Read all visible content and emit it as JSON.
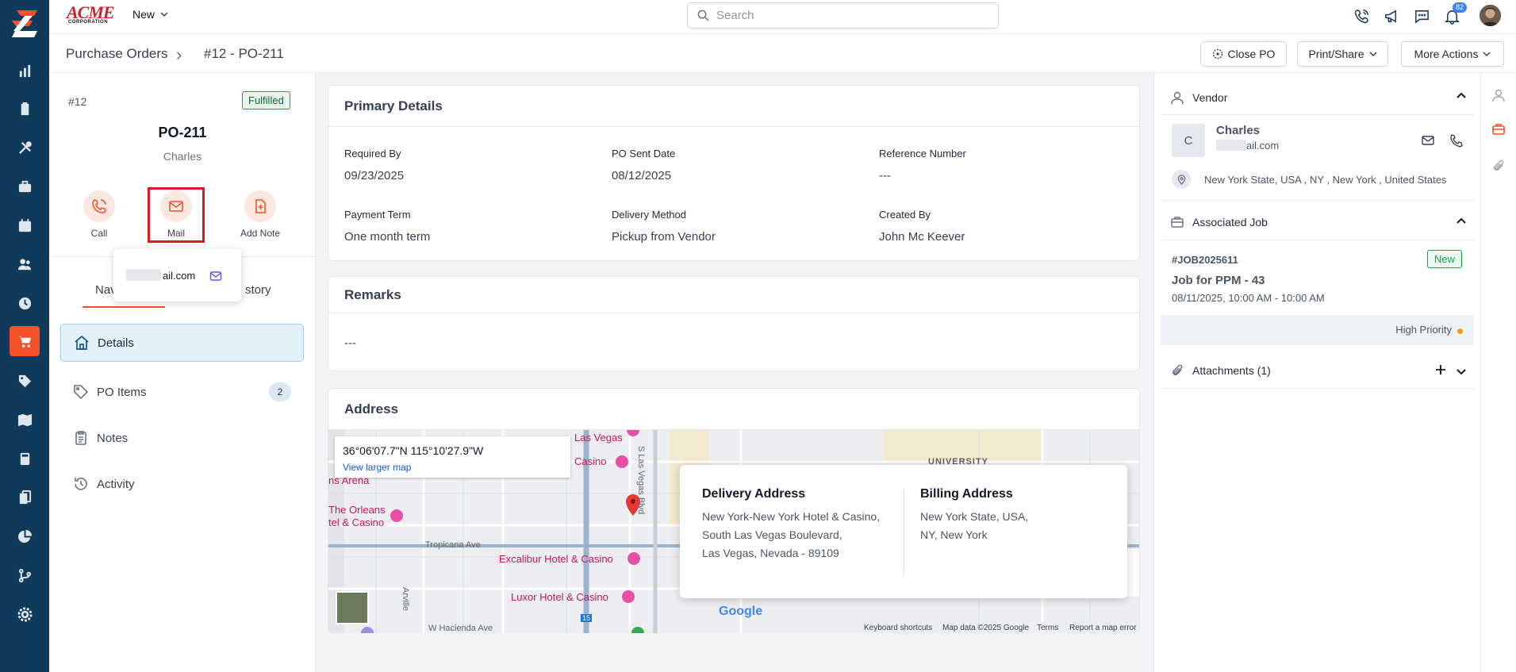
{
  "app": {
    "brand_name": "ACME",
    "brand_sub": "CORPORATION",
    "new_label": "New",
    "search_placeholder": "Search",
    "notifications_count": "82"
  },
  "rail": {
    "items": [
      "chart-icon",
      "clipboard-icon",
      "tools-icon",
      "briefcase-icon",
      "calendar-icon",
      "users-icon",
      "clock-icon",
      "cart-icon",
      "tag-icon",
      "map-icon",
      "calculator-icon",
      "documents-icon",
      "pie-chart-icon",
      "workflow-icon",
      "gear-icon"
    ],
    "active": "cart-icon",
    "active_color": "#f4512c",
    "bg_color": "#0f3a5a"
  },
  "breadcrumb": {
    "root": "Purchase Orders",
    "sep": "›",
    "current": "#12 - PO-211"
  },
  "header_actions": {
    "close_po": "Close PO",
    "print_share": "Print/Share",
    "more_actions": "More Actions"
  },
  "po": {
    "number": "#12",
    "status": "Fulfilled",
    "title": "PO-211",
    "vendor": "Charles",
    "actions": {
      "call": "Call",
      "mail": "Mail",
      "add_note": "Add Note"
    },
    "mail_popover_email": "ail.com"
  },
  "tabs": {
    "first": "Nav",
    "second": "story"
  },
  "nav": [
    {
      "label": "Details",
      "active": true
    },
    {
      "label": "PO Items",
      "count": "2"
    },
    {
      "label": "Notes"
    },
    {
      "label": "Activity"
    }
  ],
  "primary": {
    "heading": "Primary Details",
    "fields": [
      {
        "key": "Required By",
        "value": "09/23/2025"
      },
      {
        "key": "PO Sent Date",
        "value": "08/12/2025"
      },
      {
        "key": "Reference Number",
        "value": "---"
      },
      {
        "key": "Payment Term",
        "value": "One month term"
      },
      {
        "key": "Delivery Method",
        "value": "Pickup from Vendor"
      },
      {
        "key": "Created By",
        "value": "John Mc Keever"
      }
    ]
  },
  "remarks": {
    "heading": "Remarks",
    "value": "---"
  },
  "address": {
    "heading": "Address",
    "map": {
      "coords": "36°06'07.7\"N 115°10'27.9\"W",
      "larger_map": "View larger map",
      "labels": {
        "las_vegas": "Las Vegas",
        "casino": "Casino",
        "arena": "ns Arena",
        "orleans_1": "The Orleans",
        "orleans_2": "tel & Casino",
        "tropicana": "Tropicana Ave",
        "excalibur": "Excalibur Hotel & Casino",
        "luxor": "Luxor Hotel & Casino",
        "hacienda": "W Hacienda Ave",
        "university": "UNIVERSITY",
        "vegas_blvd": "S Las Vegas Blvd",
        "arville": "Arville",
        "i15": "15"
      },
      "footer": {
        "shortcuts": "Keyboard shortcuts",
        "data": "Map data ©2025 Google",
        "terms": "Terms",
        "report": "Report a map error"
      },
      "google": "Google"
    },
    "delivery_title": "Delivery Address",
    "delivery_lines": [
      "New York-New York Hotel & Casino,",
      "South Las Vegas Boulevard,",
      "Las Vegas, Nevada - 89109"
    ],
    "billing_title": "Billing Address",
    "billing_lines": [
      "New York State, USA,",
      "NY, New York"
    ]
  },
  "vendor": {
    "heading": "Vendor",
    "initial": "C",
    "name": "Charles",
    "email": "ail.com",
    "location": "New York State, USA , NY , New York , United States"
  },
  "job": {
    "heading": "Associated Job",
    "number": "#JOB2025611",
    "status": "New",
    "title": "Job for PPM - 43",
    "time": "08/11/2025, 10:00 AM - 10:00 AM",
    "priority": "High Priority",
    "priority_color": "#f59e0b"
  },
  "attachments": {
    "heading": "Attachments (1)"
  }
}
